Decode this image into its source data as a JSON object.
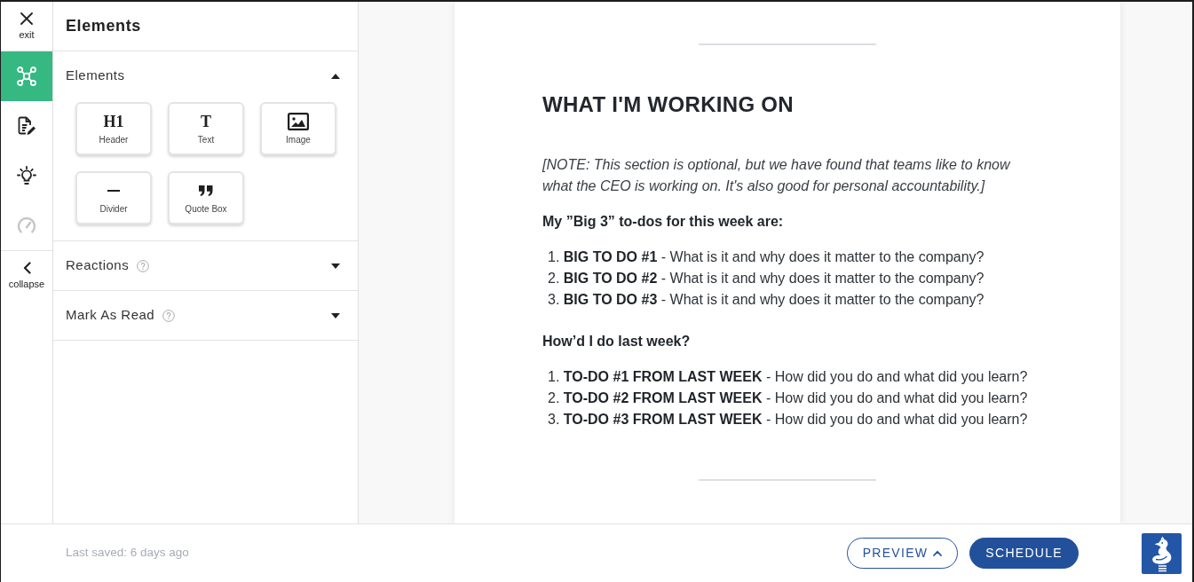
{
  "rail": {
    "exit": {
      "label": "exit"
    },
    "tools": [
      {
        "selected": true,
        "disabled": false
      },
      {
        "selected": false,
        "disabled": false
      },
      {
        "selected": false,
        "disabled": false
      },
      {
        "selected": false,
        "disabled": true
      }
    ],
    "collapse": {
      "label": "collapse"
    }
  },
  "panel": {
    "title": "Elements",
    "sections": [
      {
        "title": "Elements",
        "expanded": true,
        "help": false,
        "tiles": [
          {
            "label": "Header",
            "kind": "glyph",
            "glyph": "H1"
          },
          {
            "label": "Text",
            "kind": "glyph",
            "glyph": "T"
          },
          {
            "label": "Image",
            "kind": "image"
          },
          {
            "label": "Divider",
            "kind": "divider"
          },
          {
            "label": "Quote Box",
            "kind": "quote"
          }
        ]
      },
      {
        "title": "Reactions",
        "expanded": false,
        "help": true
      },
      {
        "title": "Mark As Read",
        "expanded": false,
        "help": true
      }
    ]
  },
  "document": {
    "blocks": [
      {
        "kind": "divider"
      },
      {
        "kind": "heading",
        "text": "WHAT I'M WORKING ON"
      },
      {
        "kind": "note",
        "text": "[NOTE: This section is optional, but we have found that teams like to know what the CEO is working on. It's also good for personal accountability.]"
      },
      {
        "kind": "subheading",
        "text": "My ”Big 3” to-dos for this week are:"
      },
      {
        "kind": "list",
        "items": [
          {
            "number": "1.",
            "text": "**BIG TO DO #1** - What is it and why does it matter to the company?"
          },
          {
            "number": "2.",
            "text": "**BIG TO DO #2** - What is it and why does it matter to the company?"
          },
          {
            "number": "3.",
            "text": "**BIG TO DO #3** - What is it and why does it matter to the company?"
          }
        ]
      },
      {
        "kind": "subheading",
        "text": "How’d I do last week?"
      },
      {
        "kind": "list",
        "items": [
          {
            "number": "1.",
            "text": "**TO-DO #1 FROM LAST WEEK** - How did you do and what did you learn?"
          },
          {
            "number": "2.",
            "text": "**TO-DO #2 FROM LAST WEEK** - How did you do and what did you learn?"
          },
          {
            "number": "3.",
            "text": "**TO-DO #3 FROM LAST WEEK** - How did you do and what did you learn?"
          }
        ]
      },
      {
        "kind": "divider"
      }
    ]
  },
  "footer": {
    "last_saved": "Last saved: 6 days ago",
    "buttons": [
      {
        "label": "PREVIEW",
        "kind": "outline",
        "menu": true
      },
      {
        "label": "SCHEDULE",
        "kind": "primary",
        "menu": false
      }
    ]
  }
}
